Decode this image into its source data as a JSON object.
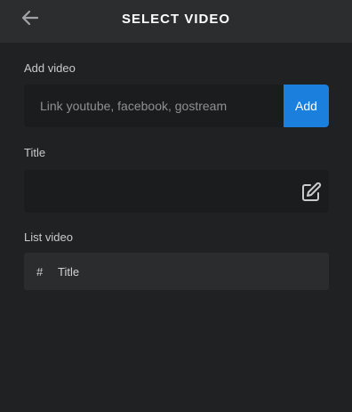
{
  "header": {
    "title": "SELECT VIDEO",
    "back_icon": "arrow-left-icon"
  },
  "add_video": {
    "label": "Add video",
    "placeholder": "Link youtube, facebook, gostream",
    "value": "",
    "button_label": "Add",
    "button_color": "#1a7fdd"
  },
  "title_field": {
    "label": "Title",
    "value": "",
    "edit_icon": "edit-icon"
  },
  "list_video": {
    "label": "List video",
    "columns": [
      "#",
      "Title"
    ]
  },
  "colors": {
    "background": "#1f2122",
    "header": "#2b2d2f",
    "input_bg": "#1b1c1e",
    "accent": "#1a7fdd"
  }
}
